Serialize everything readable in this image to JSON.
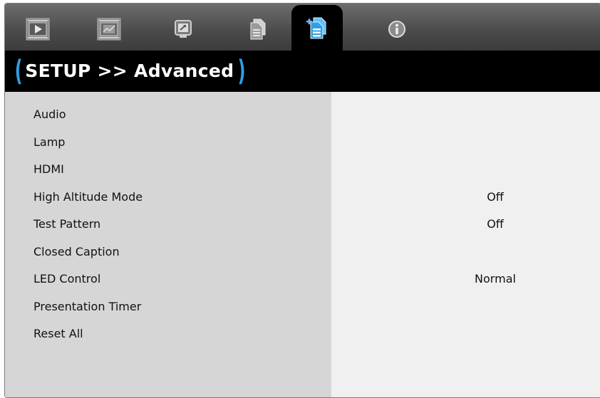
{
  "tabs": [
    {
      "name": "image-tab",
      "icon": "picture-icon"
    },
    {
      "name": "display-tab",
      "icon": "display-icon"
    },
    {
      "name": "setup-screen-tab",
      "icon": "screen-icon"
    },
    {
      "name": "document-tab",
      "icon": "document-icon"
    },
    {
      "name": "setup-advanced-tab",
      "icon": "setup-icon",
      "active": true
    },
    {
      "name": "info-tab",
      "icon": "info-icon"
    }
  ],
  "title": {
    "open_paren": "(",
    "text": "SETUP >> Advanced",
    "close_paren": ")"
  },
  "menu": [
    {
      "label": "Audio",
      "value": ""
    },
    {
      "label": "Lamp",
      "value": ""
    },
    {
      "label": "HDMI",
      "value": ""
    },
    {
      "label": "High Altitude Mode",
      "value": "Off"
    },
    {
      "label": "Test Pattern",
      "value": "Off"
    },
    {
      "label": "Closed Caption",
      "value": ""
    },
    {
      "label": "LED Control",
      "value": "Normal"
    },
    {
      "label": "Presentation Timer",
      "value": ""
    },
    {
      "label": "Reset All",
      "value": ""
    }
  ],
  "colors": {
    "accent": "#2e9fe6",
    "title_bg": "#000000",
    "left_panel": "#d6d6d6",
    "right_panel": "#f0f0f0"
  }
}
